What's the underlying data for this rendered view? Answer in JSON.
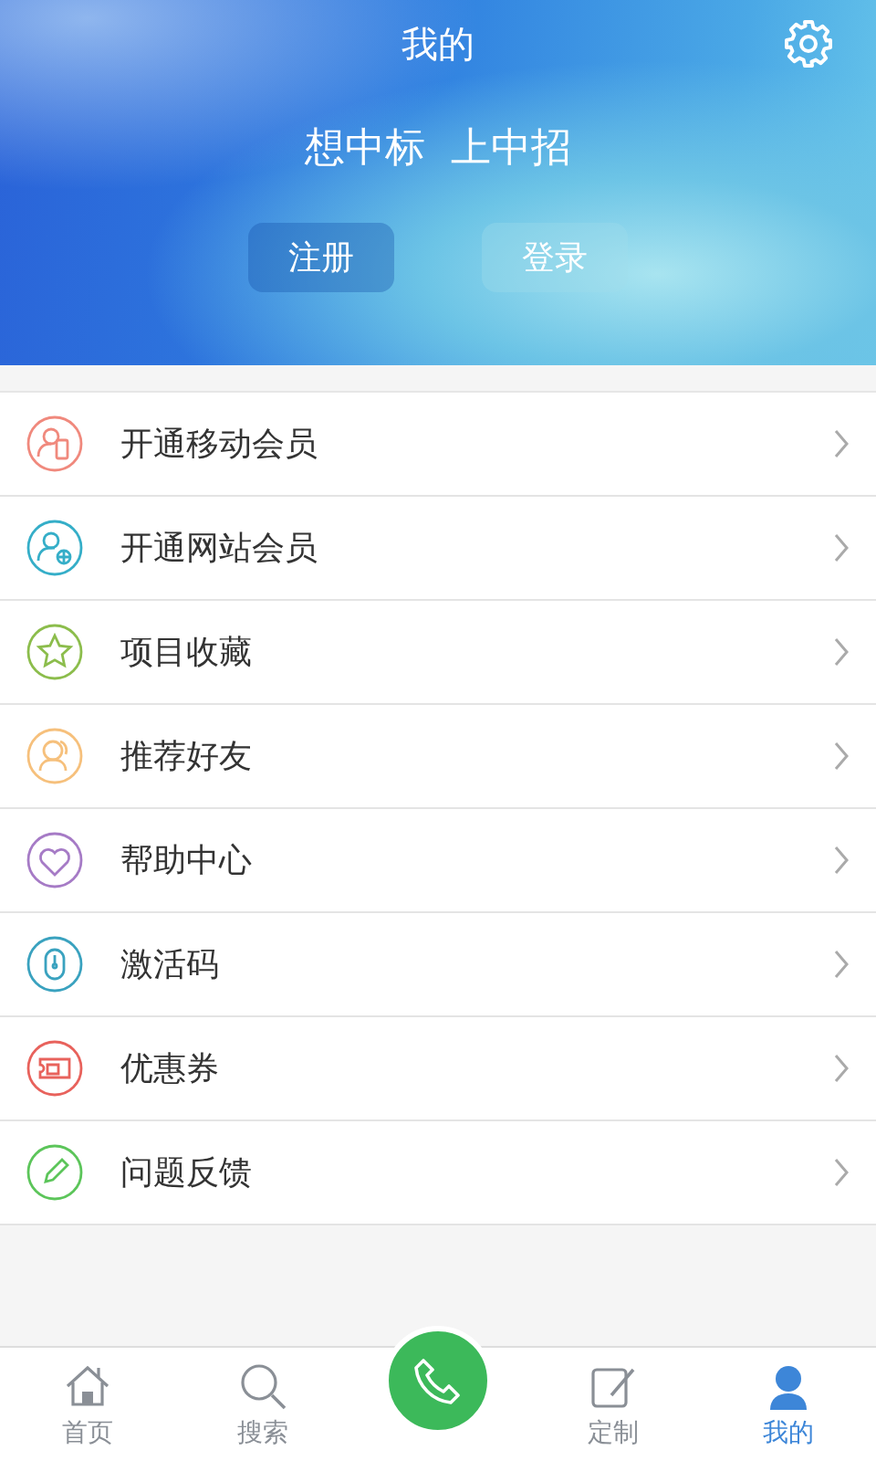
{
  "header": {
    "title": "我的",
    "slogan": [
      "想中标",
      "上中招"
    ],
    "buttons": [
      {
        "label": "注册",
        "selected": true
      },
      {
        "label": "登录",
        "selected": false
      }
    ]
  },
  "menu": [
    {
      "label": "开通移动会员",
      "color": "#f0897d"
    },
    {
      "label": "开通网站会员",
      "color": "#35aec8"
    },
    {
      "label": "项目收藏",
      "color": "#8cbd4c"
    },
    {
      "label": "推荐好友",
      "color": "#f6c07c"
    },
    {
      "label": "帮助中心",
      "color": "#a67bc6"
    },
    {
      "label": "激活码",
      "color": "#3aa2bf"
    },
    {
      "label": "优惠券",
      "color": "#e8625c"
    },
    {
      "label": "问题反馈",
      "color": "#5cc55a"
    }
  ],
  "tabs": [
    {
      "label": "首页",
      "selected": false
    },
    {
      "label": "搜索",
      "selected": false
    },
    {
      "label": "定制",
      "selected": false
    },
    {
      "label": "我的",
      "selected": true
    }
  ]
}
